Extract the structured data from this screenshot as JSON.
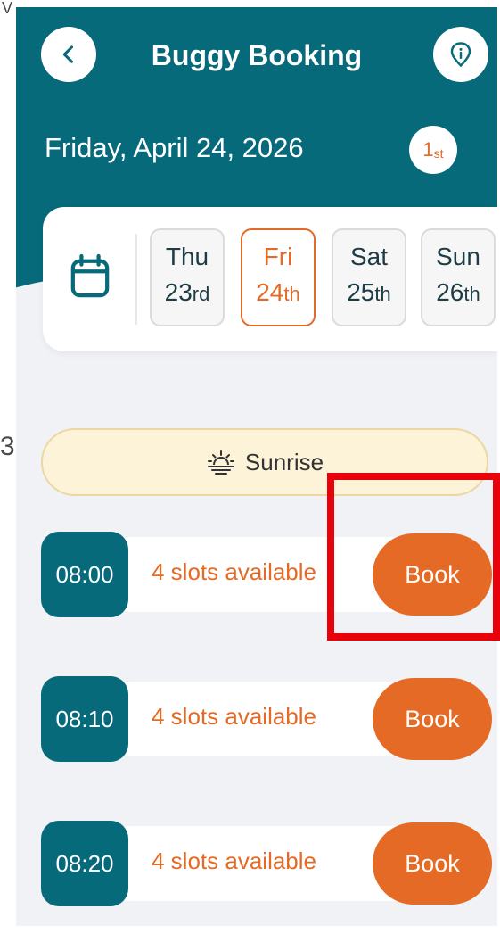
{
  "header": {
    "title": "Buggy Booking",
    "date": "Friday, April 24, 2026",
    "badge_num": "1",
    "badge_suffix": "st"
  },
  "week": {
    "days": [
      {
        "name": "Thu",
        "num": "23",
        "suffix": "rd",
        "selected": false
      },
      {
        "name": "Fri",
        "num": "24",
        "suffix": "th",
        "selected": true
      },
      {
        "name": "Sat",
        "num": "25",
        "suffix": "th",
        "selected": false
      },
      {
        "name": "Sun",
        "num": "26",
        "suffix": "th",
        "selected": false
      }
    ]
  },
  "section": {
    "label": "Sunrise",
    "icon": "sunrise-icon"
  },
  "slots": [
    {
      "time": "08:00",
      "availability": "4 slots available",
      "action": "Book"
    },
    {
      "time": "08:10",
      "availability": "4 slots available",
      "action": "Book"
    },
    {
      "time": "08:20",
      "availability": "4 slots available",
      "action": "Book"
    }
  ],
  "stray_marks": {
    "top": "V",
    "middle": "3"
  },
  "colors": {
    "primary": "#076a7b",
    "accent": "#e46a25",
    "background": "#f0f2f5",
    "sunrise_bg": "#fcf3d9",
    "highlight": "#e8000b"
  }
}
